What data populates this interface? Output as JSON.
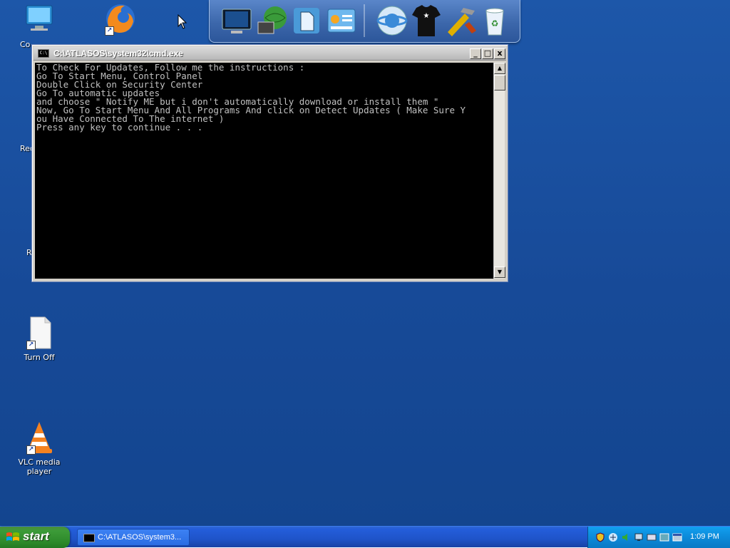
{
  "desktop": {
    "icons": [
      {
        "label": "Co",
        "name": "my-computer-icon"
      },
      {
        "label": "",
        "name": "firefox-icon"
      },
      {
        "label": "Rec",
        "name": "recycle-bin-icon"
      },
      {
        "label": "R",
        "name": "restart-icon"
      },
      {
        "label": "Turn Off",
        "name": "turn-off-icon"
      },
      {
        "label": "VLC media player",
        "name": "vlc-icon"
      }
    ]
  },
  "dock": {
    "items": [
      "monitor-icon",
      "network-icon",
      "documents-icon",
      "control-panel-icon",
      "internet-icon",
      "themes-icon",
      "tools-icon",
      "recycle-bin-icon"
    ]
  },
  "cmd_window": {
    "title": "C:\\ATLASOS\\system32\\cmd.exe",
    "icon_text": "C:\\",
    "controls": {
      "minimize": "_",
      "maximize": "□",
      "close": "x"
    },
    "lines": [
      "To Check For Updates, Follow me the instructions :",
      "Go To Start Menu, Control Panel",
      "Double Click on Security Center",
      "Go To automatic updates",
      "and choose \" Notify ME but i don't automatically download or install them \"",
      "Now, Go To Start Menu And All Programs And click on Detect Updates ( Make Sure Y",
      "ou Have Connected To The internet )",
      "Press any key to continue . . ."
    ]
  },
  "taskbar": {
    "start_label": "start",
    "task_label": "C:\\ATLASOS\\system3...",
    "clock": "1:09 PM",
    "tray_icons": [
      "security-shield-icon",
      "network-tray-icon",
      "speaker-tray-icon",
      "monitor-tray-icon",
      "keyboard-tray-icon",
      "display-tray-icon",
      "window-tray-icon",
      "sound-tray-icon"
    ]
  },
  "colors": {
    "desktop": "#1a4d9e",
    "taskbar": "#245edb",
    "start": "#3c9b38",
    "tray": "#0c8ad9",
    "console_bg": "#000000",
    "console_fg": "#c0c0c0"
  }
}
